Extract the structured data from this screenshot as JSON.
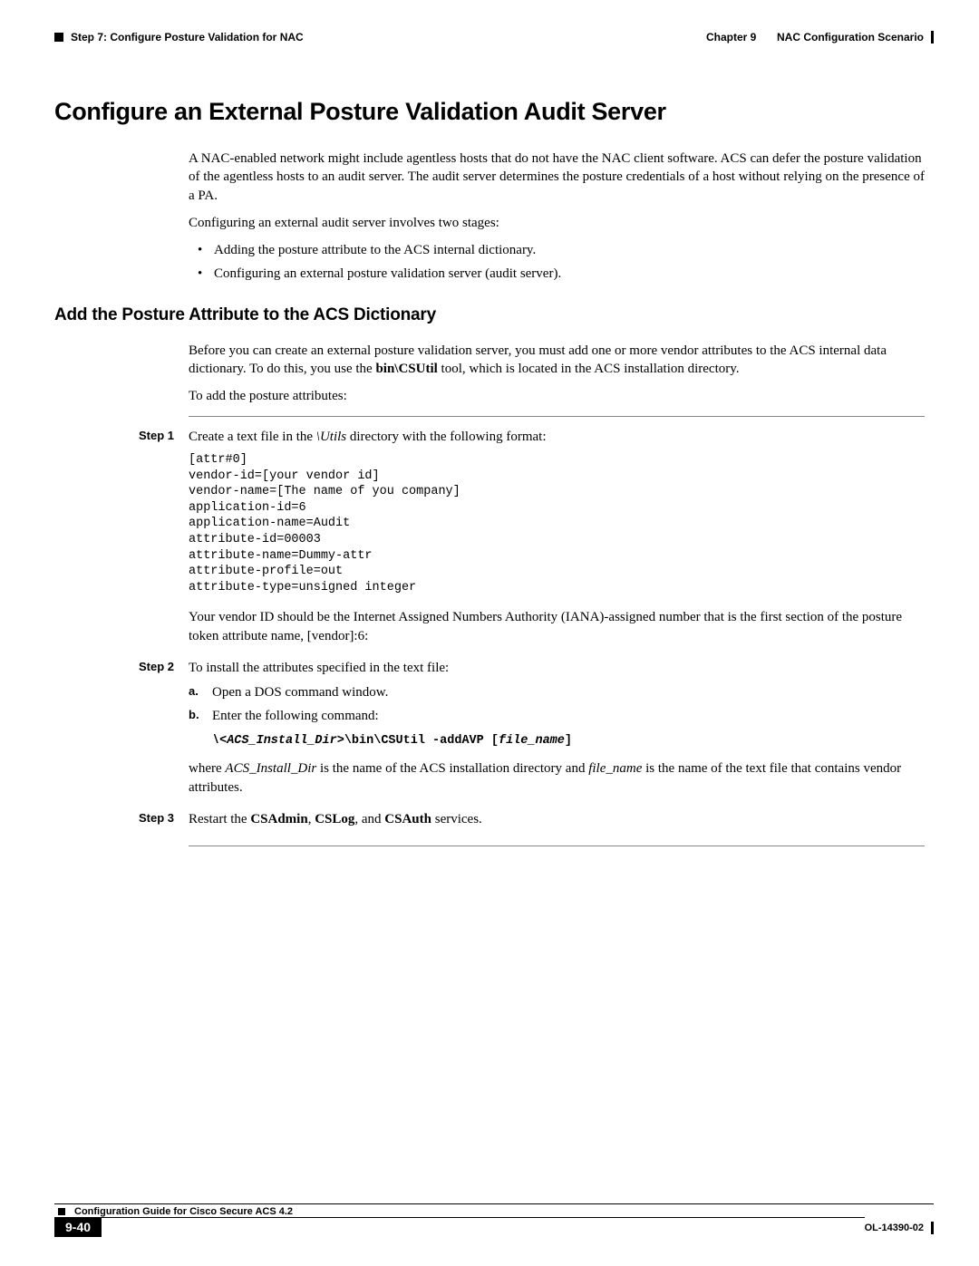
{
  "header": {
    "left_text": "Step 7: Configure Posture Validation for NAC",
    "right_chapter": "Chapter 9",
    "right_title": "NAC Configuration Scenario"
  },
  "section": {
    "title": "Configure an External Posture Validation Audit Server",
    "para1": "A NAC-enabled network might include agentless hosts that do not have the NAC client software. ACS can defer the posture validation of the agentless hosts to an audit server. The audit server determines the posture credentials of a host without relying on the presence of a PA.",
    "para2": "Configuring an external audit server involves two stages:",
    "bullets": [
      "Adding the posture attribute to the ACS internal dictionary.",
      "Configuring an external posture validation server (audit server)."
    ]
  },
  "subsection": {
    "title": "Add the Posture Attribute to the ACS Dictionary",
    "para1_pre": "Before you can create an external posture validation server, you must add one or more vendor attributes to the ACS internal data dictionary. To do this, you use the ",
    "para1_bold": "bin\\CSUtil",
    "para1_post": " tool, which is located in the ACS installation directory.",
    "para2": "To add the posture attributes:"
  },
  "steps": {
    "step1": {
      "label": "Step 1",
      "text_pre": "Create a text file in the ",
      "text_ital": "\\Utils",
      "text_post": " directory with the following format:",
      "code": "[attr#0]\nvendor-id=[your vendor id]\nvendor-name=[The name of you company]\napplication-id=6\napplication-name=Audit\nattribute-id=00003\nattribute-name=Dummy-attr\nattribute-profile=out\nattribute-type=unsigned integer",
      "after": "Your vendor ID should be the Internet Assigned Numbers Authority (IANA)-assigned number that is the first section of the posture token attribute name, [vendor]:6:"
    },
    "step2": {
      "label": "Step 2",
      "text": "To install the attributes specified in the text file:",
      "a_marker": "a.",
      "a_text": "Open a DOS command window.",
      "b_marker": "b.",
      "b_text": "Enter the following command:",
      "cmd_ital1": "\\<ACS_Install_Dir>",
      "cmd_plain": "\\bin\\CSUtil -addAVP [",
      "cmd_ital2": "file_name",
      "cmd_close": "]",
      "where_pre": "where ",
      "where_i1": "ACS_Install_Dir",
      "where_mid": " is the name of the ACS installation directory and ",
      "where_i2": "file_name",
      "where_post": " is the name of the text file that contains vendor attributes."
    },
    "step3": {
      "label": "Step 3",
      "text_pre": "Restart the ",
      "b1": "CSAdmin",
      "sep1": ", ",
      "b2": "CSLog",
      "sep2": ", and ",
      "b3": "CSAuth",
      "text_post": " services."
    }
  },
  "footer": {
    "guide_title": "Configuration Guide for Cisco Secure ACS 4.2",
    "page_num": "9-40",
    "doc_num": "OL-14390-02"
  }
}
